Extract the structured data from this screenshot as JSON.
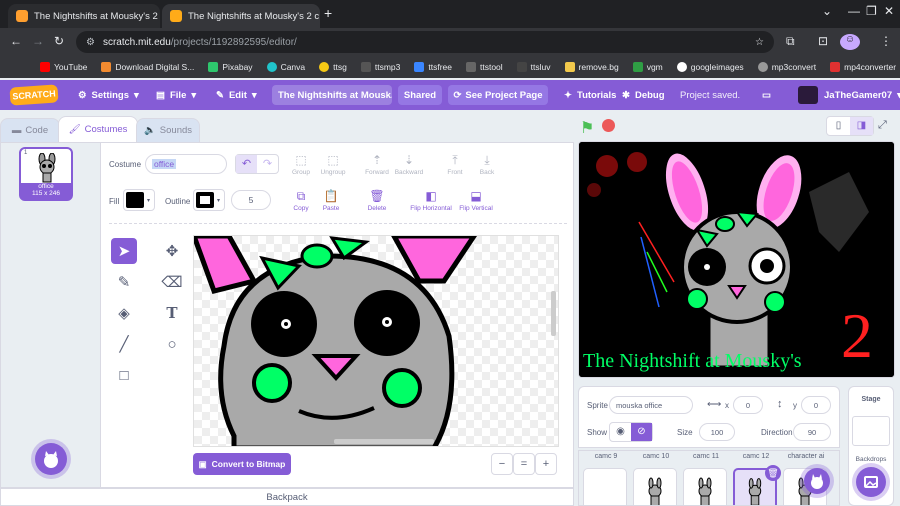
{
  "browser": {
    "tabs": [
      {
        "title": "The Nightshifts at Mousky's 2 c"
      },
      {
        "title": "The Nightshifts at Mousky's 2 c"
      }
    ],
    "new_tab_symbol": "+",
    "window_controls": {
      "minimize": "—",
      "maximize": "❐",
      "close": "✕"
    },
    "url_host": "scratch.mit.edu",
    "url_path": "/projects/1192892595/editor/",
    "bookmarks": [
      "YouTube",
      "Download Digital S...",
      "Pixabay",
      "Canva",
      "ttsg",
      "ttsmp3",
      "ttsfree",
      "ttstool",
      "ttsluv",
      "remove.bg",
      "vgm",
      "googleimages",
      "mp3convert",
      "mp4converter"
    ],
    "bookmark_more": "»"
  },
  "menu": {
    "logo": "SCRATCH",
    "settings": "Settings",
    "file": "File",
    "edit": "Edit",
    "project_title": "The Nightshifts at Mousk...",
    "shared": "Shared",
    "see_project": "See Project Page",
    "tutorials": "Tutorials",
    "debug": "Debug",
    "status": "Project saved.",
    "username": "JaTheGamer07"
  },
  "editor_tabs": {
    "code": "Code",
    "costumes": "Costumes",
    "sounds": "Sounds"
  },
  "costume_list": [
    {
      "index": "1",
      "name": "office",
      "size": "115 x 246"
    }
  ],
  "paint": {
    "costume_label": "Costume",
    "costume_name": "office",
    "fill_label": "Fill",
    "outline_label": "Outline",
    "outline_width": "5",
    "buttons": {
      "group": "Group",
      "ungroup": "Ungroup",
      "forward": "Forward",
      "backward": "Backward",
      "front": "Front",
      "back": "Back",
      "copy": "Copy",
      "paste": "Paste",
      "delete": "Delete",
      "flip_h": "Flip Horizontal",
      "flip_v": "Flip Vertical"
    },
    "convert": "Convert to Bitmap",
    "zoom_out": "−",
    "zoom_reset": "=",
    "zoom_in": "+"
  },
  "backpack": "Backpack",
  "stage": {
    "title_text": "The Nightshift at Mousky's",
    "number": "2"
  },
  "sprite_info": {
    "sprite_label": "Sprite",
    "sprite_name": "mouska office",
    "x_label": "x",
    "x": "0",
    "y_label": "y",
    "y": "0",
    "show_label": "Show",
    "size_label": "Size",
    "size": "100",
    "direction_label": "Direction",
    "direction": "90"
  },
  "sprite_names": [
    "camc 9",
    "camc 10",
    "camc 11",
    "camc 12",
    "character ai"
  ],
  "stage_panel": {
    "label": "Stage",
    "backdrops": "Backdrops"
  },
  "colors": {
    "accent": "#855cd6",
    "neon_green": "#00ff66",
    "stage_red": "#ff2020"
  }
}
